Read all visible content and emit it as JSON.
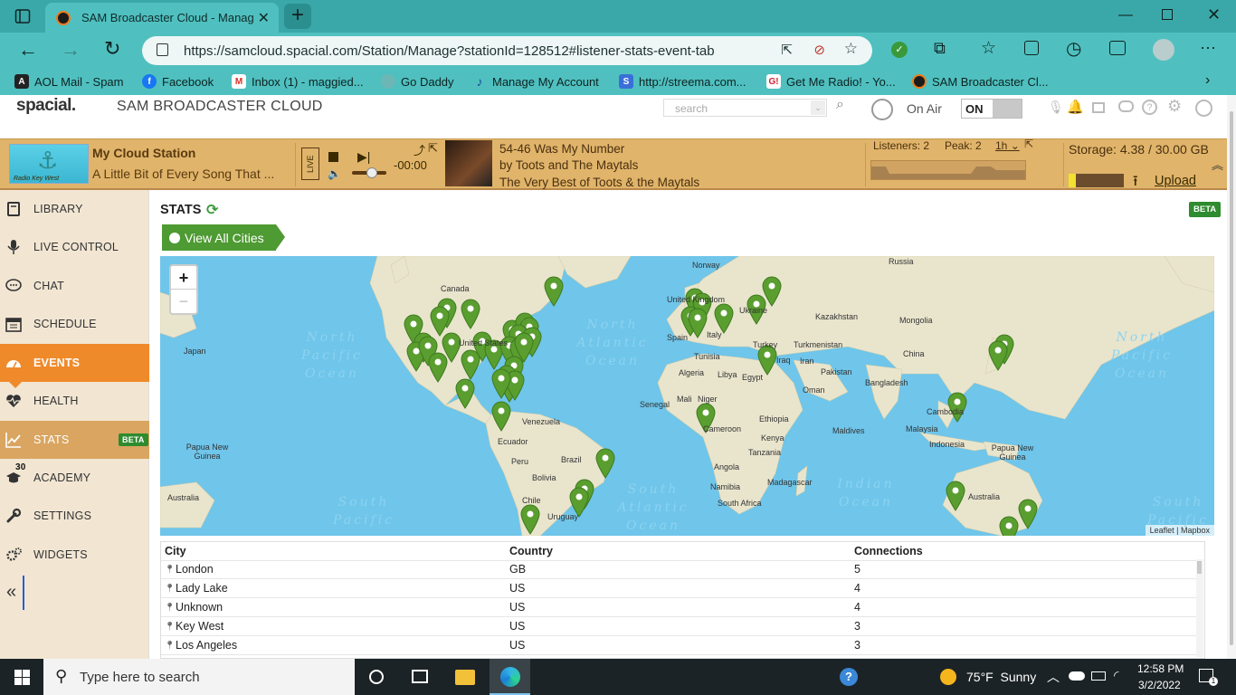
{
  "browser": {
    "tab_title": "SAM Broadcaster Cloud - Manag",
    "url": "https://samcloud.spacial.com/Station/Manage?stationId=128512#listener-stats-event-tab",
    "bookmarks": [
      "AOL Mail - Spam",
      "Facebook",
      "Inbox (1) - maggied...",
      "Go Daddy",
      "Manage My Account",
      "http://streema.com...",
      "Get Me Radio! - Yo...",
      "SAM Broadcaster Cl..."
    ]
  },
  "app": {
    "logo": "spacial.",
    "product": "SAM BROADCASTER CLOUD",
    "search_placeholder": "search",
    "on_air_label": "On Air",
    "on_label": "ON"
  },
  "player": {
    "station_name": "My Cloud Station",
    "station_tagline": "A Little Bit of Every Song That ...",
    "logo_text": "Radio Key West",
    "live_label": "LIVE",
    "time": "-00:00",
    "track_title": "54-46 Was My Number",
    "track_artist": "by Toots and The Maytals",
    "track_album": "The Very Best of Toots & the Maytals",
    "listeners": "Listeners: 2",
    "peak": "Peak: 2",
    "period": "1h",
    "storage": "Storage: 4.38 / 30.00 GB",
    "upload_label": "Upload"
  },
  "sidebar": {
    "items": [
      {
        "label": "LIBRARY"
      },
      {
        "label": "LIVE CONTROL"
      },
      {
        "label": "CHAT"
      },
      {
        "label": "SCHEDULE"
      },
      {
        "label": "EVENTS"
      },
      {
        "label": "HEALTH"
      },
      {
        "label": "STATS",
        "badge": "BETA"
      },
      {
        "label": "ACADEMY",
        "badge": "30"
      },
      {
        "label": "SETTINGS"
      },
      {
        "label": "WIDGETS"
      }
    ]
  },
  "stats": {
    "title": "STATS",
    "beta_badge": "BETA",
    "view_all_label": "View All Cities",
    "zoom_in": "+",
    "zoom_out": "−",
    "attribution": "Leaflet | Mapbox",
    "map_labels": {
      "canada": "Canada",
      "united_states": "United States",
      "russia": "Russia",
      "norway": "Norway",
      "united_kingdom": "United Kingdom",
      "ukraine": "Ukraine",
      "kazakhstan": "Kazakhstan",
      "mongolia": "Mongolia",
      "turkmenistan": "Turkmenistan",
      "turkey": "Turkey",
      "iraq": "Iraq",
      "iran": "Iran",
      "pakistan": "Pakistan",
      "china": "China",
      "japan": "Japan",
      "spain": "Spain",
      "italy": "Italy",
      "tunisia": "Tunisia",
      "algeria": "Algeria",
      "libya": "Libya",
      "egypt": "Egypt",
      "oman": "Oman",
      "bangladesh": "Bangladesh",
      "cambodia": "Cambodia",
      "malaysia": "Malaysia",
      "indonesia": "Indonesia",
      "papua_new_guinea": "Papua New Guinea",
      "australia": "Australia",
      "senegal": "Senegal",
      "mali": "Mali",
      "niger": "Niger",
      "cameroon": "Cameroon",
      "ethiopia": "Ethiopia",
      "kenya": "Kenya",
      "maldives": "Maldives",
      "tanzania": "Tanzania",
      "angola": "Angola",
      "namibia": "Namibia",
      "madagascar": "Madagascar",
      "south_africa": "South Africa",
      "venezuela": "Venezuela",
      "ecuador": "Ecuador",
      "peru": "Peru",
      "brazil": "Brazil",
      "bolivia": "Bolivia",
      "chile": "Chile",
      "uruguay": "Uruguay"
    },
    "oceans": {
      "north_pacific_left": "North Pacific Ocean",
      "north_atlantic": "North Atlantic Ocean",
      "north_pacific_right": "North Pacific Ocean",
      "indian": "Indian Ocean",
      "south_pacific_left": "South Pacific",
      "south_atlantic": "South Atlantic Ocean",
      "south_pacific_right": "South Pacific"
    },
    "table": {
      "headers": {
        "city": "City",
        "country": "Country",
        "connections": "Connections"
      },
      "rows": [
        {
          "city": "London",
          "country": "GB",
          "connections": "5"
        },
        {
          "city": "Lady Lake",
          "country": "US",
          "connections": "4"
        },
        {
          "city": "Unknown",
          "country": "US",
          "connections": "4"
        },
        {
          "city": "Key West",
          "country": "US",
          "connections": "3"
        },
        {
          "city": "Los Angeles",
          "country": "US",
          "connections": "3"
        }
      ]
    }
  },
  "taskbar": {
    "search_placeholder": "Type here to search",
    "weather": "75°F  Sunny",
    "time": "12:58 PM",
    "date": "3/2/2022"
  },
  "colors": {
    "browser_teal": "#4fc0bf",
    "player_gold": "#e0b46a",
    "accent_orange": "#ef8a2b",
    "pin_green": "#5a9e2f",
    "beta_green": "#2e8b2e"
  }
}
